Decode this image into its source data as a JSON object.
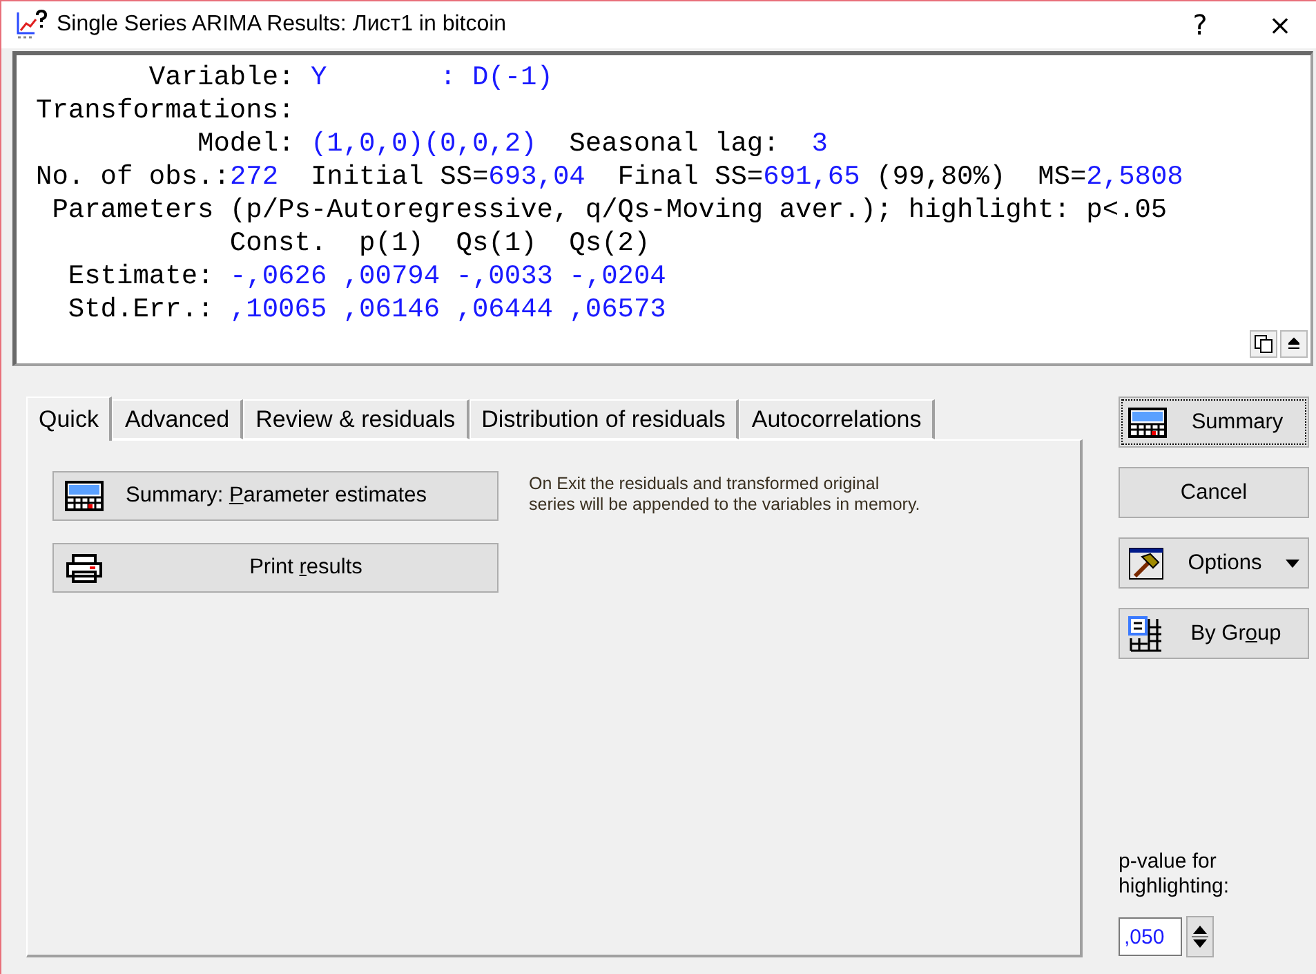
{
  "window": {
    "title": "Single Series ARIMA Results: Лист1 in bitcoin",
    "help": "?",
    "close": "×"
  },
  "output": {
    "lines": [
      [
        {
          "kind": "label",
          "text": "       Variable: "
        },
        {
          "kind": "value",
          "text": "Y       : D(-1)"
        }
      ],
      [
        {
          "kind": "label",
          "text": "Transformations:"
        }
      ],
      [
        {
          "kind": "label",
          "text": "          Model: "
        },
        {
          "kind": "value",
          "text": "(1,0,0)(0,0,2)"
        },
        {
          "kind": "label",
          "text": "  Seasonal lag:  "
        },
        {
          "kind": "value",
          "text": "3"
        }
      ],
      [
        {
          "kind": "label",
          "text": "No. of obs.:"
        },
        {
          "kind": "value",
          "text": "272"
        },
        {
          "kind": "label",
          "text": "  Initial SS="
        },
        {
          "kind": "value",
          "text": "693,04"
        },
        {
          "kind": "label",
          "text": "  Final SS="
        },
        {
          "kind": "value",
          "text": "691,65"
        },
        {
          "kind": "label",
          "text": " (99,80%)  MS="
        },
        {
          "kind": "value",
          "text": "2,5808"
        }
      ],
      [
        {
          "kind": "label",
          "text": " Parameters (p/Ps-Autoregressive, q/Qs-Moving aver.); highlight: p<.05"
        }
      ],
      [
        {
          "kind": "label",
          "text": "            Const.  p(1)  Qs(1)  Qs(2)"
        }
      ],
      [
        {
          "kind": "label",
          "text": "  Estimate: "
        },
        {
          "kind": "value",
          "text": "-,0626 ,00794 -,0033 -,0204"
        }
      ],
      [
        {
          "kind": "label",
          "text": "  Std.Err.: "
        },
        {
          "kind": "value",
          "text": ",10065 ,06146 ,06444 ,06573"
        }
      ]
    ]
  },
  "tabs": [
    {
      "label": "Quick",
      "selected": true
    },
    {
      "label": "Advanced",
      "selected": false
    },
    {
      "label": "Review & residuals",
      "selected": false
    },
    {
      "label": "Distribution of residuals",
      "selected": false
    },
    {
      "label": "Autocorrelations",
      "selected": false
    }
  ],
  "quick": {
    "buttons": [
      {
        "kind": "summary",
        "pre": "Summary:  ",
        "accel": "P",
        "post": "arameter estimates"
      },
      {
        "kind": "print",
        "pre": "Print ",
        "accel": "r",
        "post": "esults"
      }
    ],
    "note": "On Exit the residuals and transformed original series will be appended to the variables in memory."
  },
  "side_buttons": [
    {
      "kind": "summary",
      "pre": "Summary",
      "focused": true
    },
    {
      "kind": "plain",
      "pre": "Cancel",
      "focused": false
    },
    {
      "kind": "options",
      "pre": "Options",
      "focused": false
    },
    {
      "kind": "group",
      "pre": "By Gr",
      "accel": "o",
      "post": "up",
      "focused": false
    }
  ],
  "pvalue": {
    "label": "p-value for highlighting:",
    "value": ",050"
  }
}
